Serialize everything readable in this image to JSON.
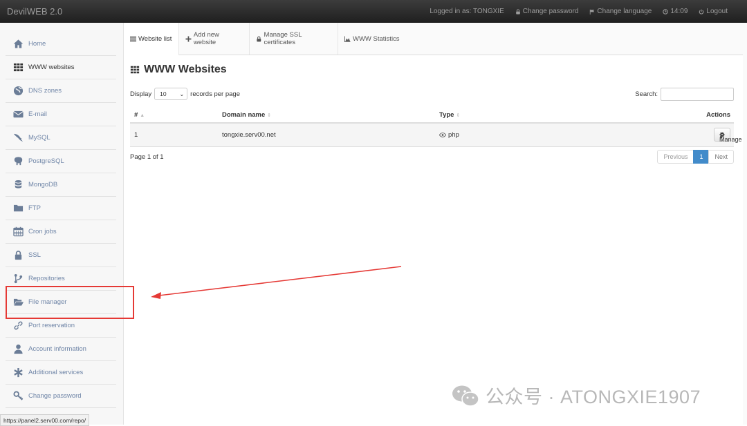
{
  "app": {
    "brand": "DevilWEB 2.0"
  },
  "topnav": {
    "logged_in": "Logged in as: TONGXIE",
    "change_password": "Change password",
    "change_language": "Change language",
    "time": "14:09",
    "logout": "Logout"
  },
  "sidebar": {
    "items": [
      {
        "label": "Home",
        "icon": "home-icon"
      },
      {
        "label": "WWW websites",
        "icon": "grid-icon"
      },
      {
        "label": "DNS zones",
        "icon": "globe-icon"
      },
      {
        "label": "E-mail",
        "icon": "envelope-icon"
      },
      {
        "label": "MySQL",
        "icon": "dolphin-icon"
      },
      {
        "label": "PostgreSQL",
        "icon": "elephant-icon"
      },
      {
        "label": "MongoDB",
        "icon": "database-icon"
      },
      {
        "label": "FTP",
        "icon": "folder-icon"
      },
      {
        "label": "Cron jobs",
        "icon": "calendar-icon"
      },
      {
        "label": "SSL",
        "icon": "lock-icon"
      },
      {
        "label": "Repositories",
        "icon": "branch-icon"
      },
      {
        "label": "File manager",
        "icon": "folder-open-icon"
      },
      {
        "label": "Port reservation",
        "icon": "link-icon"
      },
      {
        "label": "Account information",
        "icon": "user-icon"
      },
      {
        "label": "Additional services",
        "icon": "asterisk-icon"
      },
      {
        "label": "Change password",
        "icon": "key-icon"
      }
    ]
  },
  "tabs": [
    {
      "label": "Website list",
      "icon": "list-icon"
    },
    {
      "label": "Add new website",
      "icon": "plus-icon"
    },
    {
      "label": "Manage SSL certificates",
      "icon": "lock-icon"
    },
    {
      "label": "WWW Statistics",
      "icon": "area-chart-icon"
    }
  ],
  "main": {
    "title": "WWW Websites",
    "display_label": "Display",
    "records_value": "10",
    "records_suffix": "records per page",
    "search_label": "Search:",
    "search_value": "",
    "columns": {
      "num": "#",
      "domain": "Domain name",
      "type": "Type",
      "actions": "Actions"
    },
    "rows": [
      {
        "num": "1",
        "domain": "tongxie.serv00.net",
        "type": "php",
        "action": "Manage"
      }
    ],
    "page_info": "Page 1 of 1",
    "pager": {
      "previous": "Previous",
      "current": "1",
      "next": "Next"
    }
  },
  "watermark": {
    "text": "公众号 · ATONGXIE1907"
  },
  "statusbar": {
    "url": "https://panel2.serv00.com/repo/"
  },
  "colors": {
    "accent": "#428bca",
    "annotation": "#e53935",
    "link": "#6f85a7"
  }
}
